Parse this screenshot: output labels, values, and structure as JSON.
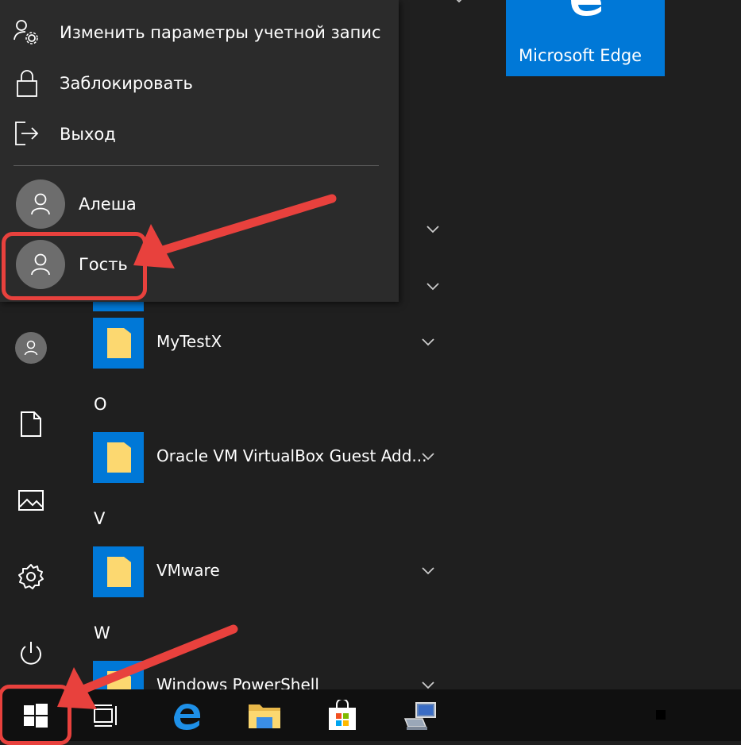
{
  "account_menu": {
    "change_settings_label": "Изменить параметры учетной запис",
    "lock_label": "Заблокировать",
    "signout_label": "Выход",
    "users": [
      {
        "name": "Алеша"
      },
      {
        "name": "Гость"
      }
    ]
  },
  "app_list": {
    "letters": [
      "O",
      "V",
      "W"
    ],
    "apps": [
      {
        "name": "MyTestX"
      },
      {
        "name": "Oracle VM VirtualBox Guest Add..."
      },
      {
        "name": "VMware"
      },
      {
        "name": "Windows PowerShell"
      }
    ]
  },
  "tiles": {
    "edge_label": "Microsoft Edge"
  },
  "rail": {
    "icons": [
      "user-icon",
      "documents-icon",
      "pictures-icon",
      "settings-icon",
      "power-icon"
    ]
  },
  "taskbar": {
    "icons": [
      "start-icon",
      "task-view-icon",
      "edge-icon",
      "file-explorer-icon",
      "store-icon",
      "network-app-icon"
    ]
  },
  "colors": {
    "accent": "#0078d7",
    "highlight": "#e8413d",
    "folder": "#fcd870"
  }
}
